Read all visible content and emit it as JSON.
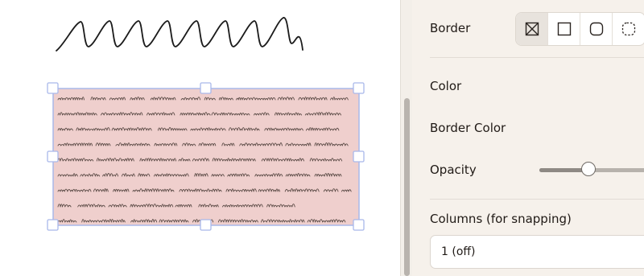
{
  "panel": {
    "border_label": "Border",
    "border_options": [
      {
        "name": "none",
        "icon": "border-none-icon",
        "selected": true
      },
      {
        "name": "square",
        "icon": "border-square-icon",
        "selected": false
      },
      {
        "name": "rounded",
        "icon": "border-rounded-icon",
        "selected": false
      },
      {
        "name": "dashed",
        "icon": "border-dashed-icon",
        "selected": false
      }
    ],
    "color_label": "Color",
    "border_color_label": "Border Color",
    "opacity_label": "Opacity",
    "opacity_value": 0.45,
    "columns_label": "Columns (for snapping)",
    "columns_value": "1 (off)"
  },
  "canvas": {
    "note_fill": "#efcfcd",
    "selection_color": "#a9b8ea"
  }
}
